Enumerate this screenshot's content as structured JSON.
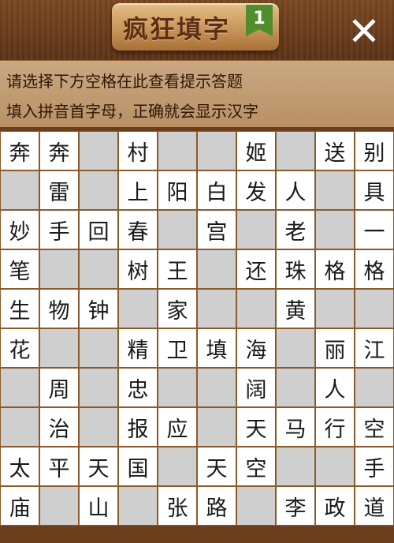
{
  "header": {
    "title": "疯狂填字",
    "level": "1",
    "close_label": "✕"
  },
  "hint": {
    "line1": "请选择下方空格在此查看提示答题",
    "line2": "填入拼音首字母，正确就会显示汉字"
  },
  "grid": [
    [
      "奔",
      "奔",
      "",
      "村",
      "",
      "",
      "姬",
      "",
      "送",
      "别"
    ],
    [
      "",
      "雷",
      "",
      "上",
      "阳",
      "白",
      "发",
      "人",
      "",
      "具"
    ],
    [
      "妙",
      "手",
      "回",
      "春",
      "",
      "宫",
      "",
      "老",
      "",
      "一"
    ],
    [
      "笔",
      "",
      "",
      "树",
      "王",
      "",
      "还",
      "珠",
      "格",
      "格"
    ],
    [
      "生",
      "物",
      "钟",
      "",
      "家",
      "",
      "",
      "黄",
      "",
      ""
    ],
    [
      "花",
      "",
      "",
      "精",
      "卫",
      "填",
      "海",
      "",
      "丽",
      "江"
    ],
    [
      "",
      "周",
      "",
      "忠",
      "",
      "",
      "阔",
      "",
      "人",
      ""
    ],
    [
      "",
      "治",
      "",
      "报",
      "应",
      "",
      "天",
      "马",
      "行",
      "空"
    ],
    [
      "太",
      "平",
      "天",
      "国",
      "",
      "天",
      "空",
      "",
      "",
      "手"
    ],
    [
      "庙",
      "",
      "山",
      "",
      "张",
      "路",
      "",
      "李",
      "政",
      "道"
    ]
  ],
  "cell_types": [
    [
      "w",
      "w",
      "g",
      "w",
      "g",
      "g",
      "w",
      "g",
      "w",
      "w"
    ],
    [
      "g",
      "w",
      "g",
      "w",
      "w",
      "w",
      "w",
      "w",
      "g",
      "w"
    ],
    [
      "w",
      "w",
      "w",
      "w",
      "g",
      "w",
      "g",
      "w",
      "g",
      "w"
    ],
    [
      "w",
      "g",
      "g",
      "w",
      "w",
      "g",
      "w",
      "w",
      "w",
      "w"
    ],
    [
      "w",
      "w",
      "w",
      "g",
      "w",
      "g",
      "g",
      "w",
      "g",
      "g"
    ],
    [
      "w",
      "g",
      "g",
      "w",
      "w",
      "w",
      "w",
      "g",
      "w",
      "w"
    ],
    [
      "g",
      "w",
      "g",
      "w",
      "g",
      "g",
      "w",
      "g",
      "w",
      "g"
    ],
    [
      "g",
      "w",
      "g",
      "w",
      "w",
      "g",
      "w",
      "w",
      "w",
      "w"
    ],
    [
      "w",
      "w",
      "w",
      "w",
      "g",
      "w",
      "w",
      "g",
      "g",
      "w"
    ],
    [
      "w",
      "g",
      "w",
      "g",
      "w",
      "w",
      "g",
      "w",
      "w",
      "w"
    ]
  ]
}
